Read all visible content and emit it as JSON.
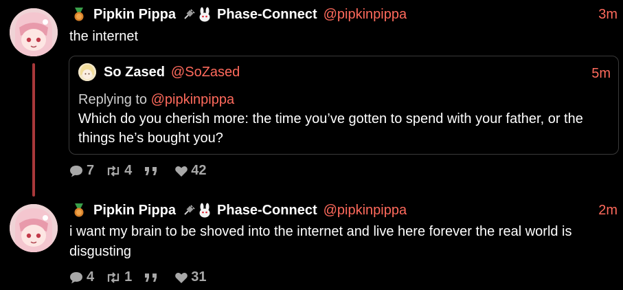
{
  "posts": [
    {
      "display_name": "Pipkin Pippa",
      "group": "Phase-Connect",
      "handle": "@pipkinpippa",
      "time": "3m",
      "text": "the internet",
      "quoted": {
        "name": "So Zased",
        "handle": "@SoZased",
        "time": "5m",
        "replying_prefix": "Replying to",
        "replying_handle": "@pipkinpippa",
        "text": "Which do you cherish more: the time you’ve gotten to spend with your father, or the things he’s bought you?"
      },
      "replies": "7",
      "reposts": "4",
      "likes": "42"
    },
    {
      "display_name": "Pipkin Pippa",
      "group": "Phase-Connect",
      "handle": "@pipkinpippa",
      "time": "2m",
      "text": "i want my brain to be shoved into the internet and live here forever the real world is disgusting",
      "replies": "4",
      "reposts": "1",
      "likes": "31"
    }
  ],
  "colors": {
    "background": "#000000",
    "accent": "#ff6a5c",
    "muted": "#a8a8a8",
    "thread_line": "#a8383a",
    "border": "#3a3a3a"
  },
  "icons": [
    "medal-icon",
    "plug-icon",
    "bunny-icon",
    "reply-icon",
    "repost-icon",
    "quote-icon",
    "heart-icon"
  ]
}
